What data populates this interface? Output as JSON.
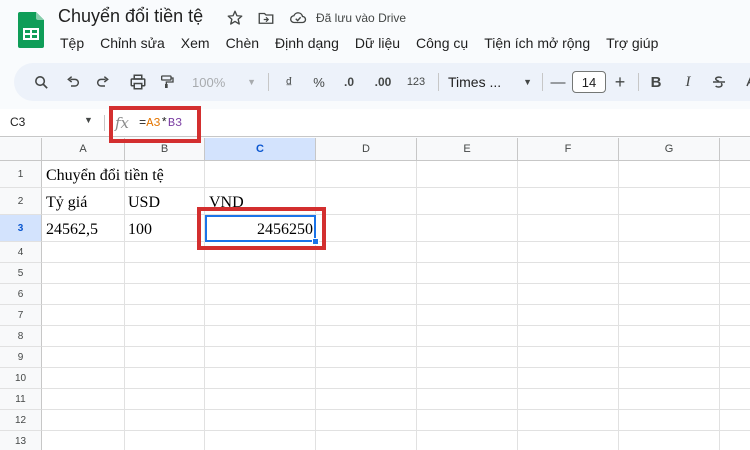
{
  "doc": {
    "title": "Chuyển đổi tiền tệ",
    "saved_status": "Đã lưu vào Drive"
  },
  "menu": [
    "Tệp",
    "Chỉnh sửa",
    "Xem",
    "Chèn",
    "Định dạng",
    "Dữ liệu",
    "Công cụ",
    "Tiện ích mở rộng",
    "Trợ giúp"
  ],
  "toolbar": {
    "zoom": "100%",
    "currency": "₫",
    "percent": "%",
    "decrease_decimal": ".0",
    "increase_decimal": ".00",
    "number_format": "123",
    "font": "Times ...",
    "font_size": "14",
    "minus": "—",
    "plus": "+",
    "bold": "B",
    "italic": "I"
  },
  "formula_bar": {
    "name_box": "C3",
    "fx": "fx",
    "formula_eq": "=",
    "formula_ref1": "A3",
    "formula_op": "*",
    "formula_ref2": "B3"
  },
  "columns": [
    "A",
    "B",
    "C",
    "D",
    "E",
    "F",
    "G"
  ],
  "rows": [
    "1",
    "2",
    "3",
    "4",
    "5",
    "6",
    "7",
    "8",
    "9",
    "10",
    "11",
    "12",
    "13"
  ],
  "cells": {
    "A1": "Chuyển đổi tiền tệ",
    "A2": "Tỷ giá",
    "B2": "USD",
    "C2": "VND",
    "A3": "24562,5",
    "B3": "100",
    "C3": "2456250"
  },
  "colors": {
    "accent": "#1a73e8",
    "highlight": "#d32f2f",
    "sheets_green": "#0f9d58"
  }
}
